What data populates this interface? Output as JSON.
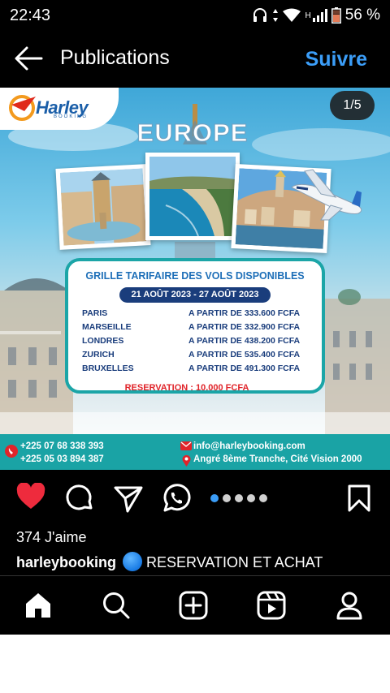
{
  "status_bar": {
    "time": "22:43",
    "network_label": "H",
    "battery": "56 %",
    "icons": [
      "headset-icon",
      "data-arrows-icon",
      "wifi-icon",
      "signal-icon",
      "battery-icon"
    ]
  },
  "header": {
    "title": "Publications",
    "follow_label": "Suivre",
    "back_icon": "arrow-left-icon"
  },
  "post": {
    "page_counter": "1/5",
    "carousel": {
      "total": 5,
      "active": 1
    },
    "image": {
      "logo_name": "Harley",
      "logo_sub": "BOOKING",
      "headline": "EUROPE",
      "fare_title": "GRILLE TARIFAIRE DES VOLS DISPONIBLES",
      "fare_dates": "21 AOÛT 2023 - 27 AOÛT 2023",
      "fares": [
        {
          "city": "PARIS",
          "price": "A PARTIR DE 333.600 FCFA"
        },
        {
          "city": "MARSEILLE",
          "price": "A PARTIR DE 332.900 FCFA"
        },
        {
          "city": "LONDRES",
          "price": "A PARTIR DE 438.200 FCFA"
        },
        {
          "city": "ZURICH",
          "price": "A PARTIR DE 535.400 FCFA"
        },
        {
          "city": "BRUXELLES",
          "price": "A PARTIR DE 491.300 FCFA"
        }
      ],
      "reservation": "RESERVATION : 10.000 FCFA",
      "phone_1": "+225 07 68 338 393",
      "phone_2": "+225 05 03 894 387",
      "email": "info@harleybooking.com",
      "address": "Angré 8ème Tranche, Cité Vision 2000"
    },
    "likes": "374 J'aime",
    "caption_user": "harleybooking",
    "caption_text": "RESERVATION ET ACHAT"
  },
  "actions": [
    "heart-icon",
    "comment-icon",
    "share-icon",
    "whatsapp-icon",
    "bookmark-icon"
  ],
  "bottom_nav": [
    "home-icon",
    "search-icon",
    "create-icon",
    "reels-icon",
    "profile-icon"
  ],
  "colors": {
    "accent": "#3b9df7",
    "like": "#ee2b3d",
    "teal": "#1aa3a5",
    "navy": "#1a3d7c",
    "reservation_red": "#e0242a"
  }
}
